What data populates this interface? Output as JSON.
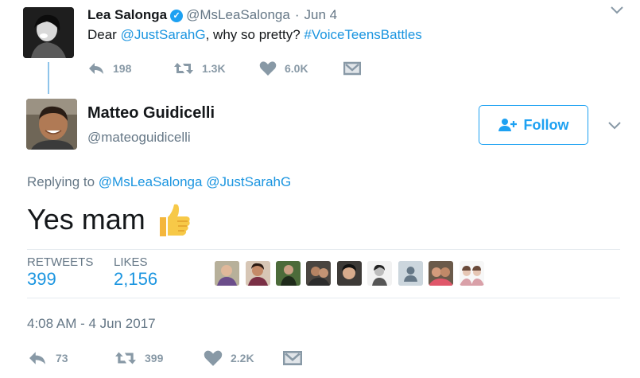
{
  "parent_tweet": {
    "name": "Lea Salonga",
    "handle": "@MsLeaSalonga",
    "dot": "·",
    "date": "Jun 4",
    "text_prefix": "Dear ",
    "mention": "@JustSarahG",
    "text_middle": ", why so pretty? ",
    "hashtag": "#VoiceTeensBattles",
    "replies": "198",
    "retweets": "1.3K",
    "likes": "6.0K",
    "icons": [
      "verified-badge-icon",
      "reply-icon",
      "retweet-icon",
      "heart-icon",
      "message-icon",
      "chevron-down-icon"
    ]
  },
  "main_tweet": {
    "name": "Matteo Guidicelli",
    "handle": "@mateoguidicelli",
    "follow_label": "Follow",
    "replying_label": "Replying to ",
    "reply_mention_1": "@MsLeaSalonga",
    "reply_mention_2": "@JustSarahG",
    "text": "Yes mam",
    "emoji": "thumbs-up",
    "stats": {
      "retweets_label": "RETWEETS",
      "retweets_value": "399",
      "likes_label": "LIKES",
      "likes_value": "2,156"
    },
    "timestamp": "4:08 AM - 4 Jun 2017",
    "actions": {
      "replies": "73",
      "retweets": "399",
      "likes": "2.2K"
    },
    "icons": [
      "follow-person-icon",
      "chevron-down-icon",
      "reply-icon",
      "retweet-icon",
      "heart-icon",
      "message-icon"
    ]
  },
  "colors": {
    "link": "#1b95e0",
    "secondary_text": "#657786",
    "icon_gray": "#8899a6",
    "divider": "#e6ecf0",
    "thread_line": "#8ec4ea",
    "brand_blue": "#1da1f2"
  }
}
